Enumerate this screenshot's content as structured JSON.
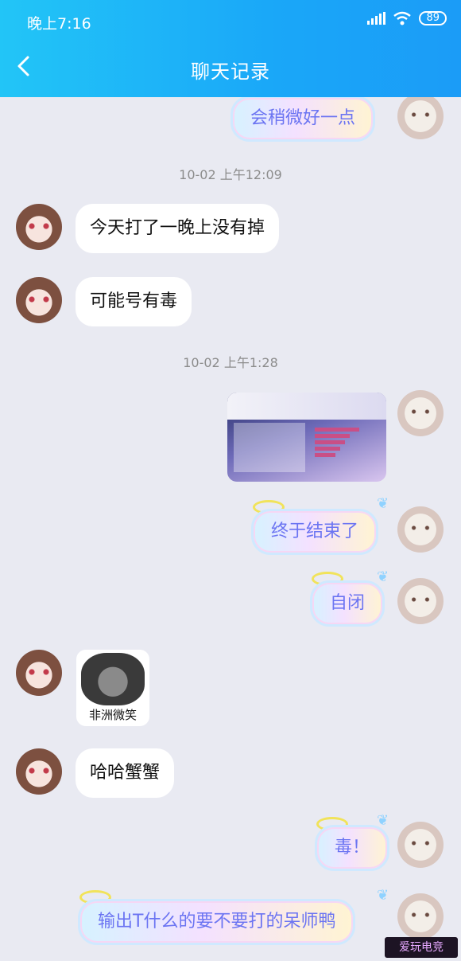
{
  "status": {
    "time": "晚上7:16",
    "battery": "89"
  },
  "header": {
    "title": "聊天记录"
  },
  "messages": {
    "m0": "会稍微好一点",
    "ts1": "10-02 上午12:09",
    "m1": "今天打了一晚上没有掉",
    "m2": "可能号有毒",
    "ts2": "10-02 上午1:28",
    "m4": "终于结束了",
    "m5": "自闭",
    "sticker_caption": "非洲微笑",
    "m7": "哈哈蟹蟹",
    "m8": "毒！",
    "m9": "输出T什么的要不要打的呆师鸭"
  },
  "watermark": "爱玩电竞"
}
